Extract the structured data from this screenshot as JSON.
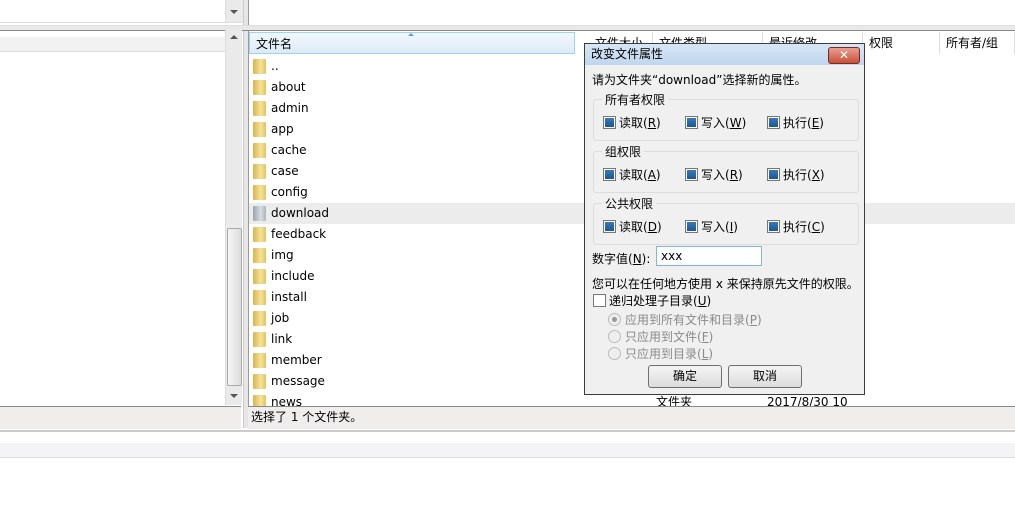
{
  "columns": [
    "文件名",
    "文件大小",
    "文件类型",
    "最近修改",
    "权限",
    "所有者/组"
  ],
  "files": [
    "..",
    "about",
    "admin",
    "app",
    "cache",
    "case",
    "config",
    "download",
    "feedback",
    "img",
    "include",
    "install",
    "job",
    "link",
    "member",
    "message",
    "news"
  ],
  "selected_index": 7,
  "last_row": {
    "type": "文件夹",
    "modified": "2017/8/30 10"
  },
  "status": "选择了 1 个文件夹。",
  "dialog": {
    "title": "改变文件属性",
    "close": "✕",
    "prompt": "请为文件夹“download”选择新的属性。",
    "groups": [
      {
        "label": "所有者权限",
        "items": [
          {
            "text": "读取(",
            "key": "R",
            "checked": true
          },
          {
            "text": "写入(",
            "key": "W",
            "checked": true
          },
          {
            "text": "执行(",
            "key": "E",
            "checked": true
          }
        ]
      },
      {
        "label": "组权限",
        "items": [
          {
            "text": "读取(",
            "key": "A",
            "checked": true
          },
          {
            "text": "写入(",
            "key": "R",
            "checked": true
          },
          {
            "text": "执行(",
            "key": "X",
            "checked": true
          }
        ]
      },
      {
        "label": "公共权限",
        "items": [
          {
            "text": "读取(",
            "key": "D",
            "checked": true
          },
          {
            "text": "写入(",
            "key": "I",
            "checked": true
          },
          {
            "text": "执行(",
            "key": "C",
            "checked": true
          }
        ]
      }
    ],
    "numeric_label": "数字值(",
    "numeric_key": "N",
    "numeric_value": "xxx",
    "hint": "您可以在任何地方使用 x 来保持原先文件的权限。",
    "recurse_label": "递归处理子目录(",
    "recurse_key": "U",
    "recurse_checked": false,
    "radios": [
      {
        "text": "应用到所有文件和目录(",
        "key": "P",
        "selected": true
      },
      {
        "text": "只应用到文件(",
        "key": "F",
        "selected": false
      },
      {
        "text": "只应用到目录(",
        "key": "L",
        "selected": false
      }
    ],
    "ok": "确定",
    "cancel": "取消"
  }
}
